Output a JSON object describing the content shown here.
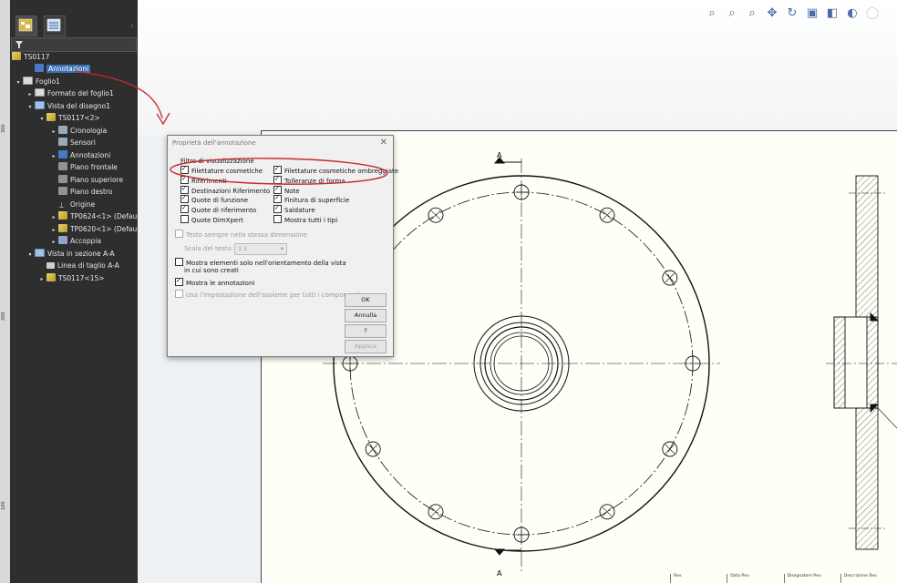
{
  "ruler": {
    "ticks": [
      "300",
      "200",
      "100"
    ]
  },
  "tree": {
    "root": "TS0117",
    "items": [
      {
        "label": "Annotazioni",
        "icon": "annotations-icon",
        "indent": 1,
        "twisty": "",
        "selected": true
      },
      {
        "label": "Foglio1",
        "icon": "sheet-icon",
        "indent": 0,
        "twisty": "▾"
      },
      {
        "label": "Formato del foglio1",
        "icon": "sheet-format-icon",
        "indent": 1,
        "twisty": "▸"
      },
      {
        "label": "Vista del disegno1",
        "icon": "drawing-view-icon",
        "indent": 1,
        "twisty": "▾"
      },
      {
        "label": "TS0117<2>",
        "icon": "part-icon",
        "indent": 2,
        "twisty": "▾"
      },
      {
        "label": "Cronologia",
        "icon": "history-icon",
        "indent": 3,
        "twisty": "▸"
      },
      {
        "label": "Sensori",
        "icon": "sensor-icon",
        "indent": 3,
        "twisty": ""
      },
      {
        "label": "Annotazioni",
        "icon": "annotations-icon",
        "indent": 3,
        "twisty": "▸"
      },
      {
        "label": "Piano frontale",
        "icon": "plane-icon",
        "indent": 3,
        "twisty": ""
      },
      {
        "label": "Piano superiore",
        "icon": "plane-icon",
        "indent": 3,
        "twisty": ""
      },
      {
        "label": "Piano destro",
        "icon": "plane-icon",
        "indent": 3,
        "twisty": ""
      },
      {
        "label": "Origine",
        "icon": "origin-icon",
        "indent": 3,
        "twisty": ""
      },
      {
        "label": "TP0624<1> (Default-",
        "icon": "part-icon",
        "indent": 3,
        "twisty": "▸"
      },
      {
        "label": "TP0620<1> (Default-",
        "icon": "part-icon",
        "indent": 3,
        "twisty": "▸"
      },
      {
        "label": "Accoppia",
        "icon": "mates-icon",
        "indent": 3,
        "twisty": "▸"
      },
      {
        "label": "Vista in sezione A-A",
        "icon": "section-view-icon",
        "indent": 1,
        "twisty": "▾"
      },
      {
        "label": "Linea di taglio A-A",
        "icon": "cutting-line-icon",
        "indent": 2,
        "twisty": ""
      },
      {
        "label": "TS0117<15>",
        "icon": "part-icon",
        "indent": 2,
        "twisty": "▸"
      }
    ]
  },
  "toolbar": {
    "icons": [
      "zoom-to-fit-icon",
      "zoom-to-area-icon",
      "zoom-in-out-icon",
      "pan-icon",
      "rotate-icon",
      "view-orientation-icon",
      "display-style-icon",
      "hide-show-icon",
      "appearance-icon"
    ]
  },
  "dialog": {
    "title": "Proprietà dell'annotazione",
    "group_label": "Filtro di visualizzazione",
    "filters_left": [
      {
        "label": "Filettature cosmetiche",
        "checked": true
      },
      {
        "label": "Riferimenti",
        "checked": true
      },
      {
        "label": "Destinazioni Riferimento",
        "checked": true
      },
      {
        "label": "Quote di funzione",
        "checked": true
      },
      {
        "label": "Quote di riferimento",
        "checked": true
      },
      {
        "label": "Quote DimXpert",
        "checked": false
      }
    ],
    "filters_right": [
      {
        "label": "Filettature cosmetiche ombreggiate",
        "checked": true
      },
      {
        "label": "Tolleranze di forma",
        "checked": true
      },
      {
        "label": "Note",
        "checked": true
      },
      {
        "label": "Finitura di superficie",
        "checked": true
      },
      {
        "label": "Saldature",
        "checked": true
      },
      {
        "label": "Mostra tutti i tipi",
        "checked": false
      }
    ],
    "text_same_size": "Testo sempre nella stessa dimensione",
    "text_scale_label": "Scala del testo:",
    "text_scale_value": "1:1",
    "show_in_orientation_line1": "Mostra elementi solo nell'orientamento della vista",
    "show_in_orientation_line2": "in cui sono creati",
    "show_annotations": "Mostra le annotazioni",
    "use_assembly_setting": "Usa l'impostazione dell'assieme per tutti i componenti",
    "buttons": {
      "ok": "OK",
      "cancel": "Annulla",
      "help": "?",
      "apply": "Applica"
    }
  },
  "drawing": {
    "section_label_top": "A",
    "section_label_bottom": "A"
  },
  "title_block": [
    "Rev.",
    "Data Rev.",
    "Disegnatore Rev.",
    "Descrizione Rev."
  ],
  "colors": {
    "selection": "#3b6fb6",
    "annotation_red": "#c8282d",
    "panel_bg": "#2e2e2e"
  }
}
